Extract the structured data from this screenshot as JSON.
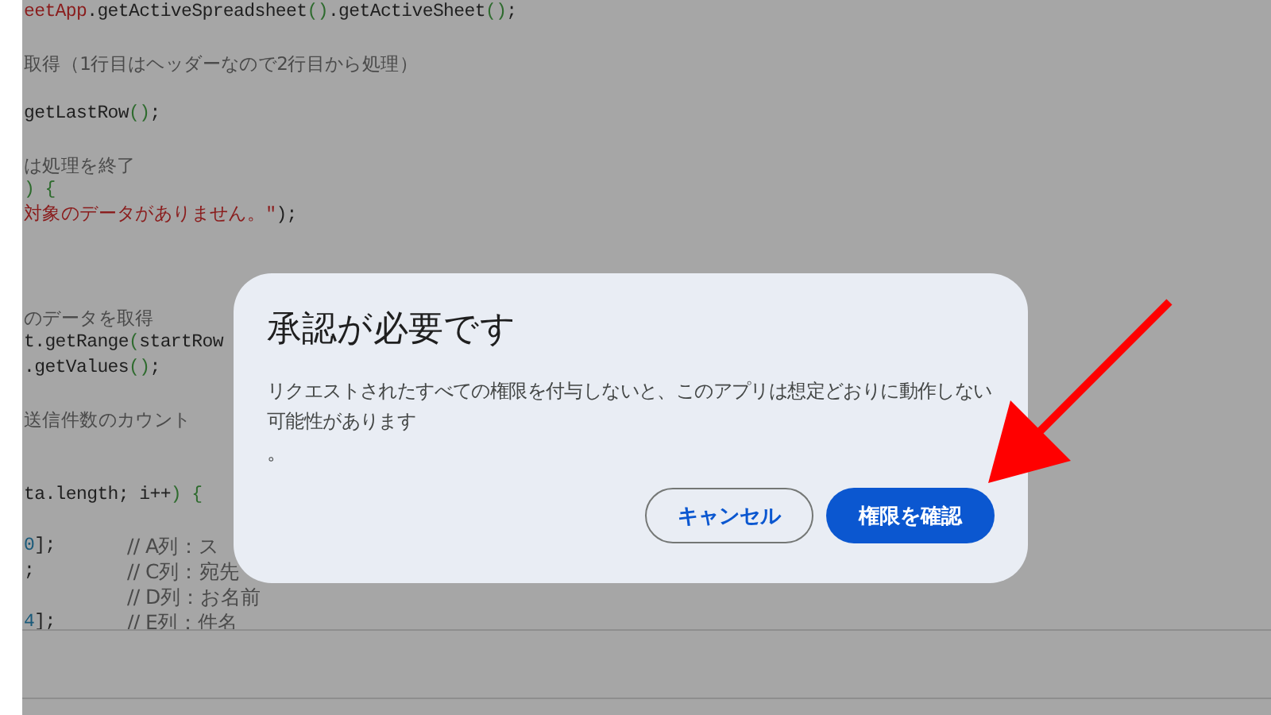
{
  "code_lines": [
    {
      "kind": "code",
      "segments": [
        {
          "text": "eetApp",
          "kind": "string"
        },
        {
          "text": ".getActiveSpreadsheet",
          "kind": "code"
        },
        {
          "text": "()",
          "kind": "punct"
        },
        {
          "text": ".getActiveSheet",
          "kind": "code"
        },
        {
          "text": "()",
          "kind": "punct"
        },
        {
          "text": ";",
          "kind": "code"
        }
      ]
    },
    {
      "kind": "blank"
    },
    {
      "kind": "code",
      "segments": [
        {
          "text": "取得（1行目はヘッダーなので2行目から処理）",
          "kind": "comment"
        }
      ]
    },
    {
      "kind": "blank"
    },
    {
      "kind": "code",
      "segments": [
        {
          "text": "getLastRow",
          "kind": "code"
        },
        {
          "text": "()",
          "kind": "punct"
        },
        {
          "text": ";",
          "kind": "code"
        }
      ]
    },
    {
      "kind": "blank"
    },
    {
      "kind": "code",
      "segments": [
        {
          "text": "は処理を終了",
          "kind": "comment"
        }
      ]
    },
    {
      "kind": "code",
      "segments": [
        {
          "text": ")",
          "kind": "punct"
        },
        {
          "text": " {",
          "kind": "punct"
        }
      ]
    },
    {
      "kind": "code",
      "segments": [
        {
          "text": "対象のデータがありません。\"",
          "kind": "string"
        },
        {
          "text": ");",
          "kind": "code"
        }
      ]
    },
    {
      "kind": "blank"
    },
    {
      "kind": "blank"
    },
    {
      "kind": "blank"
    },
    {
      "kind": "code",
      "segments": [
        {
          "text": "のデータを取得",
          "kind": "comment"
        }
      ]
    },
    {
      "kind": "code",
      "segments": [
        {
          "text": "t.getRange",
          "kind": "code"
        },
        {
          "text": "(",
          "kind": "punct"
        },
        {
          "text": "startRow",
          "kind": "code"
        }
      ]
    },
    {
      "kind": "code",
      "segments": [
        {
          "text": ".getValues",
          "kind": "code"
        },
        {
          "text": "()",
          "kind": "punct"
        },
        {
          "text": ";",
          "kind": "code"
        }
      ]
    },
    {
      "kind": "blank"
    },
    {
      "kind": "code",
      "segments": [
        {
          "text": "送信件数のカウント",
          "kind": "comment"
        }
      ]
    },
    {
      "kind": "blank"
    },
    {
      "kind": "blank"
    },
    {
      "kind": "code",
      "segments": [
        {
          "text": "ta.length; i++",
          "kind": "code"
        },
        {
          "text": ")",
          "kind": "punct"
        },
        {
          "text": " {",
          "kind": "punct"
        }
      ]
    },
    {
      "kind": "blank"
    },
    {
      "kind": "code",
      "segments": [
        {
          "text": "0",
          "kind": "number"
        },
        {
          "text": "];",
          "kind": "code"
        }
      ],
      "comment": "// A列：ス"
    },
    {
      "kind": "code",
      "segments": [
        {
          "text": ";",
          "kind": "code"
        }
      ],
      "comment": "// C列：宛先"
    },
    {
      "kind": "code",
      "comment": "// D列：お名前"
    },
    {
      "kind": "code",
      "segments": [
        {
          "text": "4",
          "kind": "number"
        },
        {
          "text": "];",
          "kind": "code"
        }
      ],
      "comment": "// E列：件名"
    }
  ],
  "dialog": {
    "title": "承認が必要です",
    "message": "リクエストされたすべての権限を付与しないと、このアプリは想定どおりに動作しない可能性があります",
    "message_tail": "。",
    "buttons": [
      {
        "label": "キャンセル",
        "kind": "outline"
      },
      {
        "label": "権限を確認",
        "kind": "primary"
      }
    ]
  }
}
